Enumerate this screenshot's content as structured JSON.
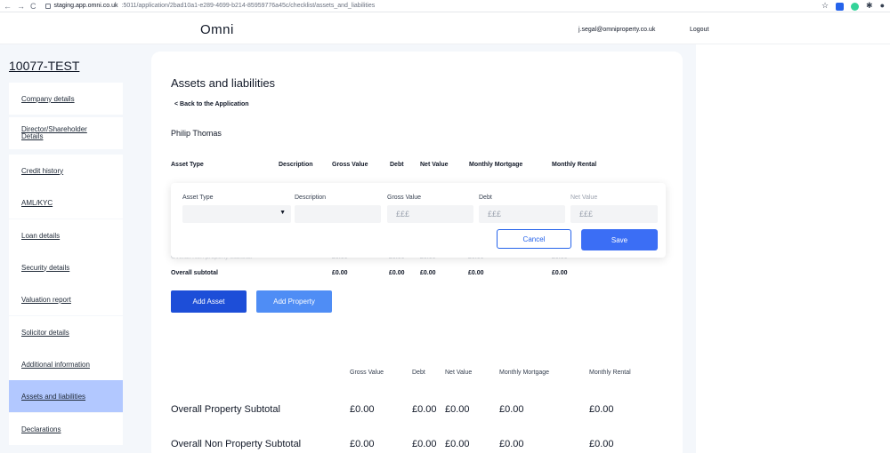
{
  "browser": {
    "nav_back": "←",
    "nav_forward": "→",
    "nav_reload": "C",
    "url_host": "staging.app.omni.co.uk",
    "url_path": ":5011/application/2bad10a1-e289-4699-b214-85959776a45c/checklist/assets_and_liabilities",
    "star": "☆",
    "puzzle": "✱",
    "profile": "●"
  },
  "header": {
    "logo": "Omni",
    "user_email": "j.segal@omniproperty.co.uk",
    "logout": "Logout"
  },
  "sidebar": {
    "case_title": "10077-TEST",
    "items": [
      {
        "label": "Company details"
      },
      {
        "label": "Director/Shareholder Details"
      },
      {
        "label": "Credit history"
      },
      {
        "label": "AML/KYC"
      },
      {
        "label": "Loan details"
      },
      {
        "label": "Security details"
      },
      {
        "label": "Valuation report"
      },
      {
        "label": "Solicitor details"
      },
      {
        "label": "Additional information"
      },
      {
        "label": "Assets and liabilities",
        "active": true
      },
      {
        "label": "Declarations"
      }
    ]
  },
  "main": {
    "title": "Assets and liabilities",
    "back_link": "< Back to the Application",
    "owner_name": "Philip Thomas",
    "table_headers": [
      "Asset Type",
      "Description",
      "Gross Value",
      "Debt",
      "Net Value",
      "Monthly Mortgage",
      "Monthly Rental"
    ],
    "partial_row": {
      "label": "Overall Non property subtotal",
      "gross": "£0.00",
      "debt": "£0.00",
      "net": "£0.00",
      "mortgage": "£0.00",
      "rental": "£0.00"
    },
    "overall_row": {
      "label": "Overall subtotal",
      "gross": "£0.00",
      "debt": "£0.00",
      "net": "£0.00",
      "mortgage": "£0.00",
      "rental": "£0.00"
    },
    "form": {
      "asset_type_label": "Asset Type",
      "description_label": "Description",
      "gross_label": "Gross Value",
      "debt_label": "Debt",
      "net_label": "Net Value",
      "gross_placeholder": "£££",
      "debt_placeholder": "£££",
      "net_placeholder": "£££",
      "cancel": "Cancel",
      "save": "Save"
    },
    "add_asset": "Add Asset",
    "add_property": "Add Property",
    "summary_headers": [
      "Gross Value",
      "Debt",
      "Net Value",
      "Monthly Mortgage",
      "Monthly Rental"
    ],
    "summary_rows": [
      {
        "label": "Overall Property Subtotal",
        "gross": "£0.00",
        "debt": "£0.00",
        "net": "£0.00",
        "mortgage": "£0.00",
        "rental": "£0.00"
      },
      {
        "label": "Overall Non Property Subtotal",
        "gross": "£0.00",
        "debt": "£0.00",
        "net": "£0.00",
        "mortgage": "£0.00",
        "rental": "£0.00"
      }
    ]
  }
}
